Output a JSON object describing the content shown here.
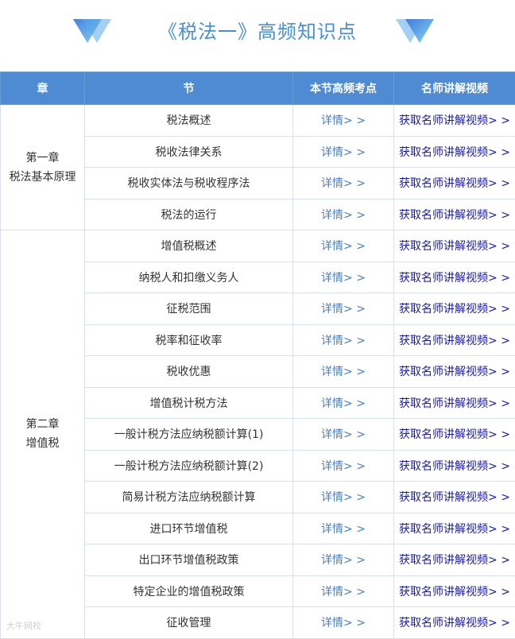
{
  "header": {
    "title": "《税法一》高频知识点"
  },
  "table": {
    "columns": [
      "章",
      "节",
      "本节高频考点",
      "名师讲解视频"
    ],
    "details_label": "详情> >",
    "video_label": "获取名师讲解视频> >",
    "chapters": [
      {
        "lines": [
          "第一章",
          "税法基本原理"
        ],
        "sections": [
          "税法概述",
          "税收法律关系",
          "税收实体法与税收程序法",
          "税法的运行"
        ]
      },
      {
        "lines": [
          "第二章",
          "增值税"
        ],
        "sections": [
          "增值税概述",
          "纳税人和扣缴义务人",
          "征税范围",
          "税率和征收率",
          "税收优惠",
          "增值税计税方法",
          "一般计税方法应纳税额计算(1)",
          "一般计税方法应纳税额计算(2)",
          "简易计税方法应纳税额计算",
          "进口环节增值税",
          "出口环节增值税政策",
          "特定企业的增值税政策",
          "征收管理"
        ]
      }
    ]
  },
  "watermark": "大牛网校",
  "colors": {
    "header_bg": "#4f8bd2",
    "title": "#4a8fd6",
    "details_link": "#4a7fbf",
    "video_link": "#1a1aa6"
  }
}
